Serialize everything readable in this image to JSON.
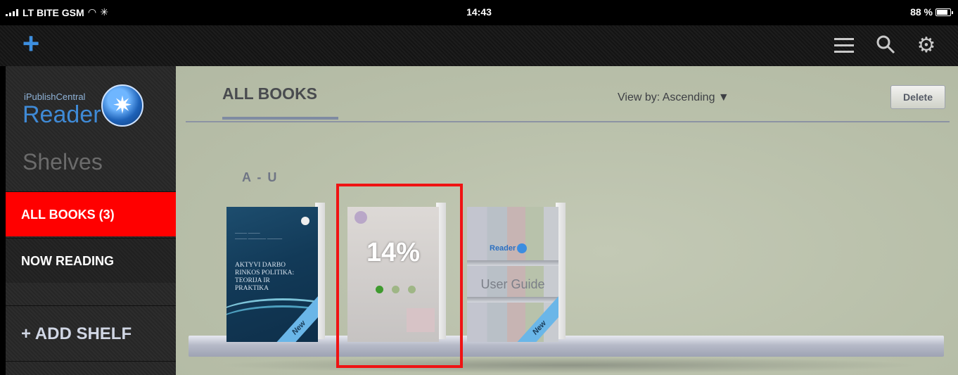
{
  "status_bar": {
    "carrier": "LT BITE GSM",
    "time": "14:43",
    "battery": "88 %"
  },
  "toolbar": {
    "add_icon": "plus-icon",
    "menu_icon": "list-icon",
    "search_icon": "search-icon",
    "settings_icon": "gear-icon"
  },
  "sidebar": {
    "logo_small": "iPublishCentral",
    "logo_big": "Reader",
    "shelves_title": "Shelves",
    "items": [
      {
        "label": "ALL BOOKS (3)",
        "selected": true
      },
      {
        "label": "NOW READING",
        "selected": false
      }
    ],
    "add_shelf": "+ ADD SHELF"
  },
  "main": {
    "title": "ALL BOOKS",
    "view_by": "View by: Ascending ▼",
    "delete": "Delete",
    "section_label": "A - U",
    "books": [
      {
        "title": "AKTYVI DARBO RINKOS POLITIKA: TEORIJA IR PRAKTIKA",
        "badge": "New"
      },
      {
        "progress": "14%",
        "highlighted": true
      },
      {
        "brand": "Reader",
        "title": "User Guide",
        "badge": "New"
      }
    ]
  },
  "colors": {
    "accent_blue": "#3d8fe0",
    "selected_red": "#ff0000",
    "highlight_red": "#ef1313",
    "main_bg": "#bcc3ad"
  }
}
